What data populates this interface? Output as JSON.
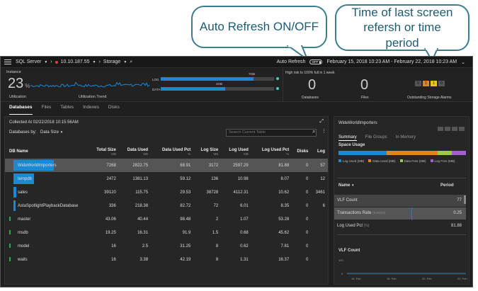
{
  "callouts": {
    "auto_refresh": "Auto Refresh ON/OFF",
    "time_period": "Time of last screen refersh or time period"
  },
  "topbar": {
    "product": "SQL Server",
    "server": "10.10.187.55",
    "section": "Storage",
    "auto_refresh_label": "Auto Refresh",
    "toggle_state": "OFF",
    "date_range": "February 15, 2018 10:23 AM - February 22, 2018 10:23 AM"
  },
  "stats": {
    "instance_label": "Instance",
    "utilization_value": "23",
    "utilization_unit": "%",
    "utilization_label": "Utilization",
    "utilization_trend_label": "Utilization Trend",
    "log_label": "LOG",
    "log_value": "7GB",
    "log_fill": 0.82,
    "data_label": "DATA",
    "data_value": "4GB",
    "data_fill": 0.57,
    "risk_label": "High risk to 100% full in 1 week",
    "databases_count": "0",
    "databases_label": "Databases",
    "files_count": "0",
    "files_label": "Files",
    "alarms_label": "Outstanding Storage Alarms",
    "alarms": [
      "0",
      "1",
      "1",
      "0"
    ],
    "alarm_colors": [
      "#555555",
      "#e0861d",
      "#e8c51e",
      "#555555"
    ]
  },
  "tabs": [
    "Databases",
    "Files",
    "Tables",
    "Indexes",
    "Disks"
  ],
  "main": {
    "collected_at": "Collected At 02/22/2018 10:15:56AM",
    "databases_by_label": "Databases by:",
    "databases_by_value": "Data Size",
    "search_placeholder": "Search Current Table",
    "columns": [
      {
        "label": "DB Name",
        "unit": ""
      },
      {
        "label": "Total Size",
        "unit": "MB"
      },
      {
        "label": "Data Used",
        "unit": "MB"
      },
      {
        "label": "Data Used Pct",
        "unit": "%"
      },
      {
        "label": "Log Size",
        "unit": "MB"
      },
      {
        "label": "Log Used",
        "unit": "MB"
      },
      {
        "label": "Log Used Pct",
        "unit": "%"
      },
      {
        "label": "Disks",
        "unit": ""
      },
      {
        "label": "Log",
        "unit": ""
      }
    ],
    "rows": [
      {
        "name": "WideWorldImporters",
        "bar": 0.52,
        "cells": [
          "7268",
          "2822.75",
          "68.91",
          "3172",
          "2597.29",
          "81.88",
          "0",
          "57"
        ]
      },
      {
        "name": "tempdb",
        "bar": 0.26,
        "cells": [
          "2472",
          "1381.13",
          "59.12",
          "136",
          "10.98",
          "8.07",
          "0",
          "12"
        ]
      },
      {
        "name": "sales",
        "bar": 0.04,
        "cells": [
          "39120",
          "115.75",
          "29.53",
          "38728",
          "4112.31",
          "10.62",
          "0",
          "3461"
        ]
      },
      {
        "name": "AstaSpotlightPlaybackDatabase",
        "bar": 0.03,
        "cells": [
          "336",
          "218.38",
          "82.72",
          "72",
          "6.01",
          "8.35",
          "0",
          "6"
        ]
      },
      {
        "name": "master",
        "bar": 0,
        "cells": [
          "43.06",
          "40.44",
          "98.48",
          "2",
          "1.07",
          "53.28",
          "0",
          ""
        ]
      },
      {
        "name": "msdb",
        "bar": 0,
        "cells": [
          "19.25",
          "16.31",
          "91.9",
          "1.5",
          "0.68",
          "45.62",
          "0",
          ""
        ]
      },
      {
        "name": "model",
        "bar": 0,
        "cells": [
          "16",
          "2.5",
          "31.25",
          "8",
          "0.62",
          "7.81",
          "0",
          ""
        ]
      },
      {
        "name": "waits",
        "bar": 0,
        "cells": [
          "16",
          "3.38",
          "42.19",
          "8",
          "1.31",
          "16.37",
          "0",
          ""
        ]
      }
    ]
  },
  "right": {
    "title": "WideWorldImporters",
    "tabs": [
      "Summary",
      "File Groups",
      "In Memory"
    ],
    "space_usage_label": "Space Usage",
    "legend": [
      {
        "label": "Log Used",
        "unit": "(MB)",
        "color": "#1a8ad4"
      },
      {
        "label": "Data Used",
        "unit": "(MB)",
        "color": "#e0861d"
      },
      {
        "label": "Data Free",
        "unit": "(MB)",
        "color": "#9bc94b"
      },
      {
        "label": "Log Free",
        "unit": "(MB)",
        "color": "#a35fd0"
      }
    ],
    "space_usage_fractions": [
      0.38,
      0.4,
      0.11,
      0.11
    ],
    "name_header": "Name",
    "period_header": "Period",
    "metrics": [
      {
        "label": "VLF Count",
        "unit": "",
        "value": "77"
      },
      {
        "label": "Transactions Rate",
        "unit": "(trans/s)",
        "value": "0.25"
      },
      {
        "label": "Log Used Pct",
        "unit": "(%)",
        "value": "81.88"
      }
    ],
    "vlf_chart_title": "VLF Count",
    "vlf_ticks_y": [
      "100",
      "0"
    ],
    "vlf_ticks_x": [
      "16. Feb",
      "18. Feb",
      "20. Feb",
      "22. Feb"
    ]
  }
}
